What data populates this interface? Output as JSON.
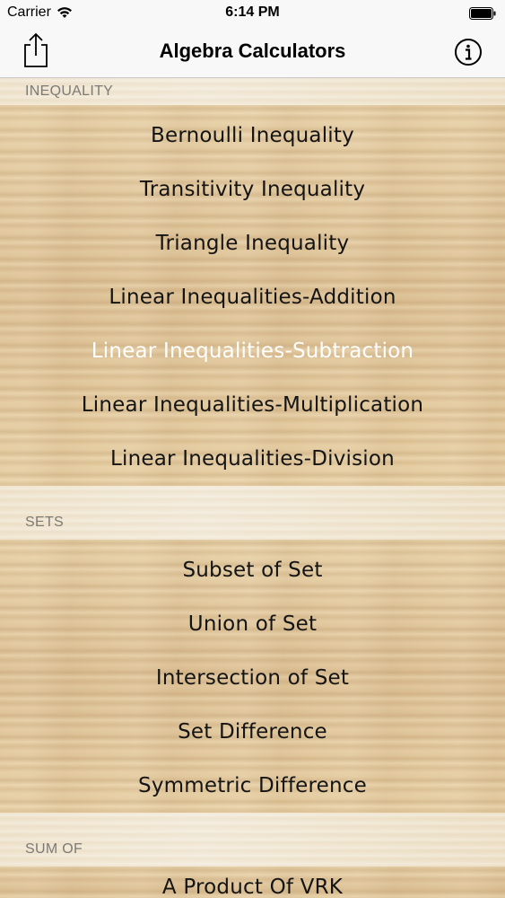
{
  "status_bar": {
    "carrier": "Carrier",
    "time": "6:14 PM"
  },
  "nav": {
    "title": "Algebra Calculators",
    "icons": {
      "left": "share-icon",
      "right": "info-icon"
    }
  },
  "sections": [
    {
      "header": "INEQUALITY",
      "items": [
        "Bernoulli Inequality",
        "Transitivity Inequality",
        "Triangle Inequality",
        "Linear Inequalities-Addition",
        "Linear Inequalities-Subtraction",
        "Linear Inequalities-Multiplication",
        "Linear Inequalities-Division"
      ],
      "highlighted_index": 4
    },
    {
      "header": "SETS",
      "items": [
        "Subset of Set",
        "Union of Set",
        "Intersection of Set",
        "Set Difference",
        "Symmetric Difference"
      ]
    },
    {
      "header": "SUM OF",
      "items": [
        "A Product Of VRK"
      ]
    }
  ],
  "colors": {
    "row_text": "#141414",
    "highlight_text": "#ffffff",
    "header_text": "#7d7a74"
  }
}
